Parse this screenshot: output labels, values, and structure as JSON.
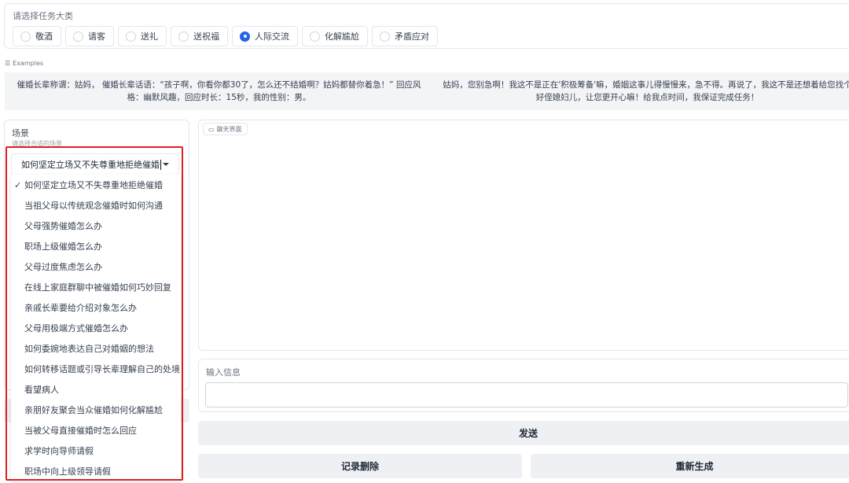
{
  "task": {
    "label": "请选择任务大类",
    "options": [
      {
        "label": "敬酒",
        "checked": false
      },
      {
        "label": "请客",
        "checked": false
      },
      {
        "label": "送礼",
        "checked": false
      },
      {
        "label": "送祝福",
        "checked": false
      },
      {
        "label": "人际交流",
        "checked": true
      },
      {
        "label": "化解尴尬",
        "checked": false
      },
      {
        "label": "矛盾应对",
        "checked": false
      }
    ]
  },
  "examples": {
    "label": "Examples",
    "items": [
      "催婚长辈称谓：姑妈， 催婚长辈话语：“孩子啊，你看你都30了，怎么还不结婚啊？姑妈都替你着急！” 回应风格：幽默风趣，回应时长：15秒，我的性别：男。",
      "姑妈，您别急啊！我这不是正在'积极筹备'嘛，婚姻这事儿得慢慢来，急不得。再说了，我这不是还想着给您找个好侄媳妇儿，让您更开心嘛！给我点时间，我保证完成任务！"
    ]
  },
  "scene": {
    "title": "场景",
    "subtitle": "请选择合适的场景",
    "selected": "如何坚定立场又不失尊重地拒绝催婚",
    "options": [
      "如何坚定立场又不失尊重地拒绝催婚",
      "当祖父母以传统观念催婚时如何沟通",
      "父母强势催婚怎么办",
      "职场上级催婚怎么办",
      "父母过度焦虑怎么办",
      "在线上家庭群聊中被催婚如何巧妙回复",
      "亲戚长辈要给介绍对象怎么办",
      "父母用极端方式催婚怎么办",
      "如何委婉地表达自己对婚姻的想法",
      "如何转移话题或引导长辈理解自己的处境",
      "看望病人",
      "亲朋好友聚会当众催婚如何化解尴尬",
      "当被父母直接催婚时怎么回应",
      "求学时向导师请假",
      "职场中向上级领导请假"
    ],
    "check_mark": "✓"
  },
  "chat": {
    "label": "聊天界面"
  },
  "input": {
    "label": "输入信息",
    "value": ""
  },
  "buttons": {
    "send": "发送",
    "delete": "记录删除",
    "regenerate": "重新生成"
  },
  "colors": {
    "accent": "#2563eb",
    "highlight_frame": "#e11d24"
  }
}
